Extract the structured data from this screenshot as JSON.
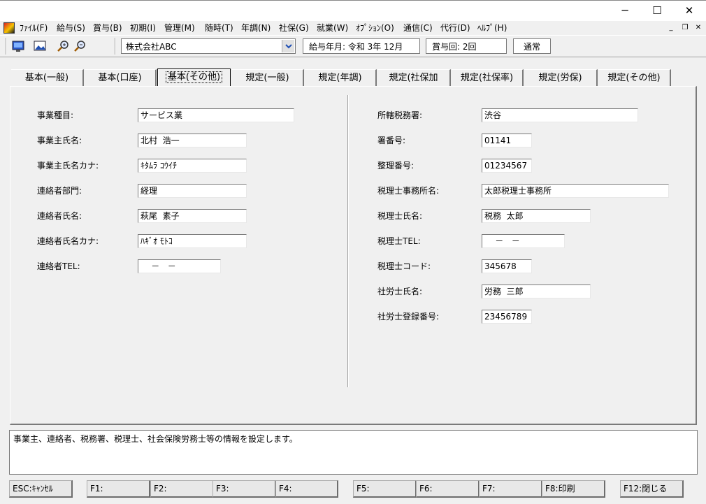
{
  "menu": [
    {
      "label": "ﾌｧｲﾙ(F)"
    },
    {
      "label": "給与(S)"
    },
    {
      "label": "賞与(B)"
    },
    {
      "label": "初期(I)"
    },
    {
      "label": "管理(M)"
    },
    {
      "label": "随時(T)"
    },
    {
      "label": "年調(N)"
    },
    {
      "label": "社保(G)"
    },
    {
      "label": "就業(W)"
    },
    {
      "label": "ｵﾌﾟｼｮﾝ(O)"
    },
    {
      "label": "通信(C)"
    },
    {
      "label": "代行(D)"
    },
    {
      "label": "ﾍﾙﾌﾟ(H)"
    }
  ],
  "toolbar": {
    "company": "株式会社ABC",
    "pay_month": "給与年月: 令和  3年 12月",
    "bonus_count": "賞与回: 2回",
    "mode": "通常"
  },
  "tabs": [
    {
      "label": "基本(一般)"
    },
    {
      "label": "基本(口座)"
    },
    {
      "label": "基本(その他)"
    },
    {
      "label": "規定(一般)"
    },
    {
      "label": "規定(年調)"
    },
    {
      "label": "規定(社保加"
    },
    {
      "label": "規定(社保率)"
    },
    {
      "label": "規定(労保)"
    },
    {
      "label": "規定(その他)"
    }
  ],
  "left_fields": [
    {
      "label": "事業種目:",
      "value": "サービス業"
    },
    {
      "label": "事業主氏名:",
      "value": "北村  浩一"
    },
    {
      "label": "事業主氏名カナ:",
      "value": "ｷﾀﾑﾗ ｺｳｲﾁ"
    },
    {
      "label": "連絡者部門:",
      "value": "経理"
    },
    {
      "label": "連絡者氏名:",
      "value": "萩尾  素子"
    },
    {
      "label": "連絡者氏名カナ:",
      "value": "ﾊｷﾞｵ ﾓﾄｺ"
    },
    {
      "label": "連絡者TEL:",
      "value": "    －   －"
    }
  ],
  "right_fields": [
    {
      "label": "所轄税務署:",
      "value": "渋谷"
    },
    {
      "label": "署番号:",
      "value": "01141"
    },
    {
      "label": "整理番号:",
      "value": "01234567"
    },
    {
      "label": "税理士事務所名:",
      "value": "太郎税理士事務所"
    },
    {
      "label": "税理士氏名:",
      "value": "税務  太郎"
    },
    {
      "label": "税理士TEL:",
      "value": "    －   －"
    },
    {
      "label": "税理士コード:",
      "value": "345678"
    },
    {
      "label": "社労士氏名:",
      "value": "労務  三郎"
    },
    {
      "label": "社労士登録番号:",
      "value": "23456789"
    }
  ],
  "status_message": "事業主、連絡者、税務署、税理士、社会保険労務士等の情報を設定します。",
  "fkeys": [
    {
      "label": "ESC:ｷｬﾝｾﾙ"
    },
    {
      "label": "F1:"
    },
    {
      "label": "F2:"
    },
    {
      "label": "F3:"
    },
    {
      "label": "F4:"
    },
    {
      "label": "F5:"
    },
    {
      "label": "F6:"
    },
    {
      "label": "F7:"
    },
    {
      "label": "F8:印刷"
    },
    {
      "label": "F12:閉じる"
    }
  ]
}
